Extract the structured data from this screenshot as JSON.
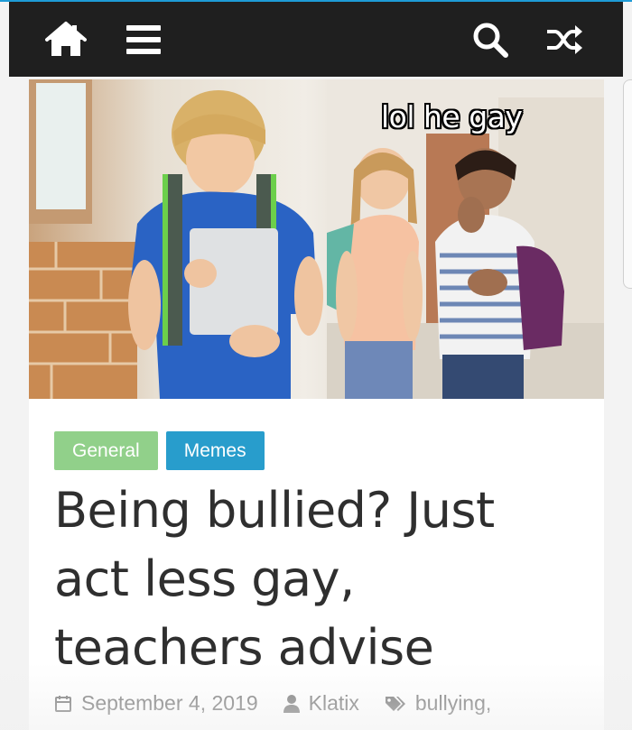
{
  "navbar": {
    "icons": [
      "home-icon",
      "menu-icon",
      "search-icon",
      "shuffle-icon"
    ]
  },
  "hero": {
    "caption": "lol he gay"
  },
  "categories": [
    {
      "label": "General",
      "color": "#91d08a"
    },
    {
      "label": "Memes",
      "color": "#289dcc"
    }
  ],
  "article": {
    "title_lines": [
      "Being bullied? Just",
      "act less gay,",
      "teachers advise"
    ],
    "date": "September 4, 2019",
    "author": "Klatix",
    "tags": "bullying,"
  },
  "colors": {
    "navbar_bg": "#1f1f1f",
    "accent": "#289dcc",
    "title_text": "#2f2f2f",
    "meta_text": "#7a7a7a"
  }
}
